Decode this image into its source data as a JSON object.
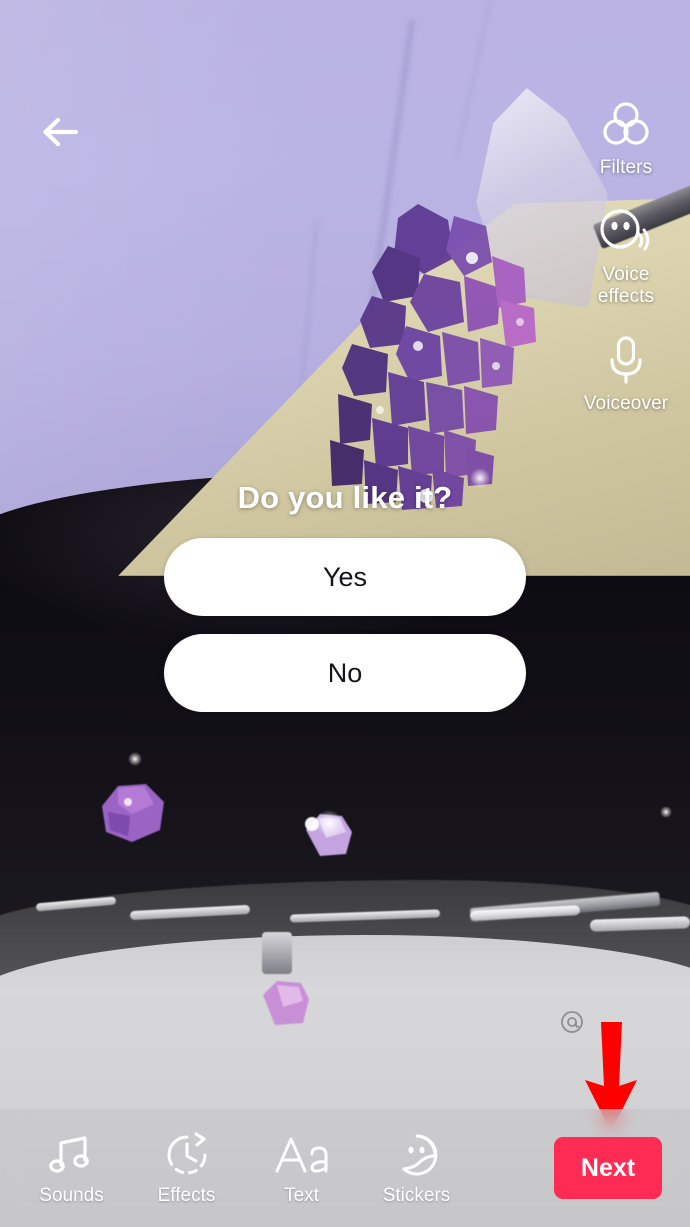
{
  "app": {
    "name": "TikTok Video Editor",
    "screen": "post-capture-edit"
  },
  "topbar": {
    "back_icon": "arrow-left-icon"
  },
  "right_rail": {
    "items": [
      {
        "label": "Filters",
        "icon": "filters-circles-icon"
      },
      {
        "label": "Voice\neffects",
        "label_line1": "Voice",
        "label_line2": "effects",
        "icon": "voice-effects-face-icon"
      },
      {
        "label": "Voiceover",
        "icon": "microphone-icon"
      }
    ]
  },
  "poll_sticker": {
    "question": "Do you like it?",
    "options": [
      {
        "label": "Yes"
      },
      {
        "label": "No"
      }
    ]
  },
  "mention": {
    "icon": "at-mention-icon"
  },
  "annotation": {
    "type": "arrow-down",
    "color": "#FF0000",
    "points_to": "next-button"
  },
  "bottom_toolbar": {
    "tools": [
      {
        "label": "Sounds",
        "icon": "music-note-icon"
      },
      {
        "label": "Effects",
        "icon": "clock-effects-icon"
      },
      {
        "label": "Text",
        "icon": "text-aa-icon"
      },
      {
        "label": "Stickers",
        "icon": "sticker-face-icon"
      }
    ],
    "next_label": "Next"
  },
  "colors": {
    "accent_next": "#FE2C55",
    "annotation_red": "#FF0000",
    "toolbar_bg": "#C4C4C8",
    "poll_option_bg": "#FFFFFF",
    "poll_option_text": "#15151A",
    "icon_white": "#FFFFFF",
    "video_lavender": "#B9B2E2",
    "video_cream": "#E0D8B6",
    "video_crystal_purple": "#6E46A8",
    "video_dark": "#100E15",
    "video_plate": "#D4D4D7"
  }
}
